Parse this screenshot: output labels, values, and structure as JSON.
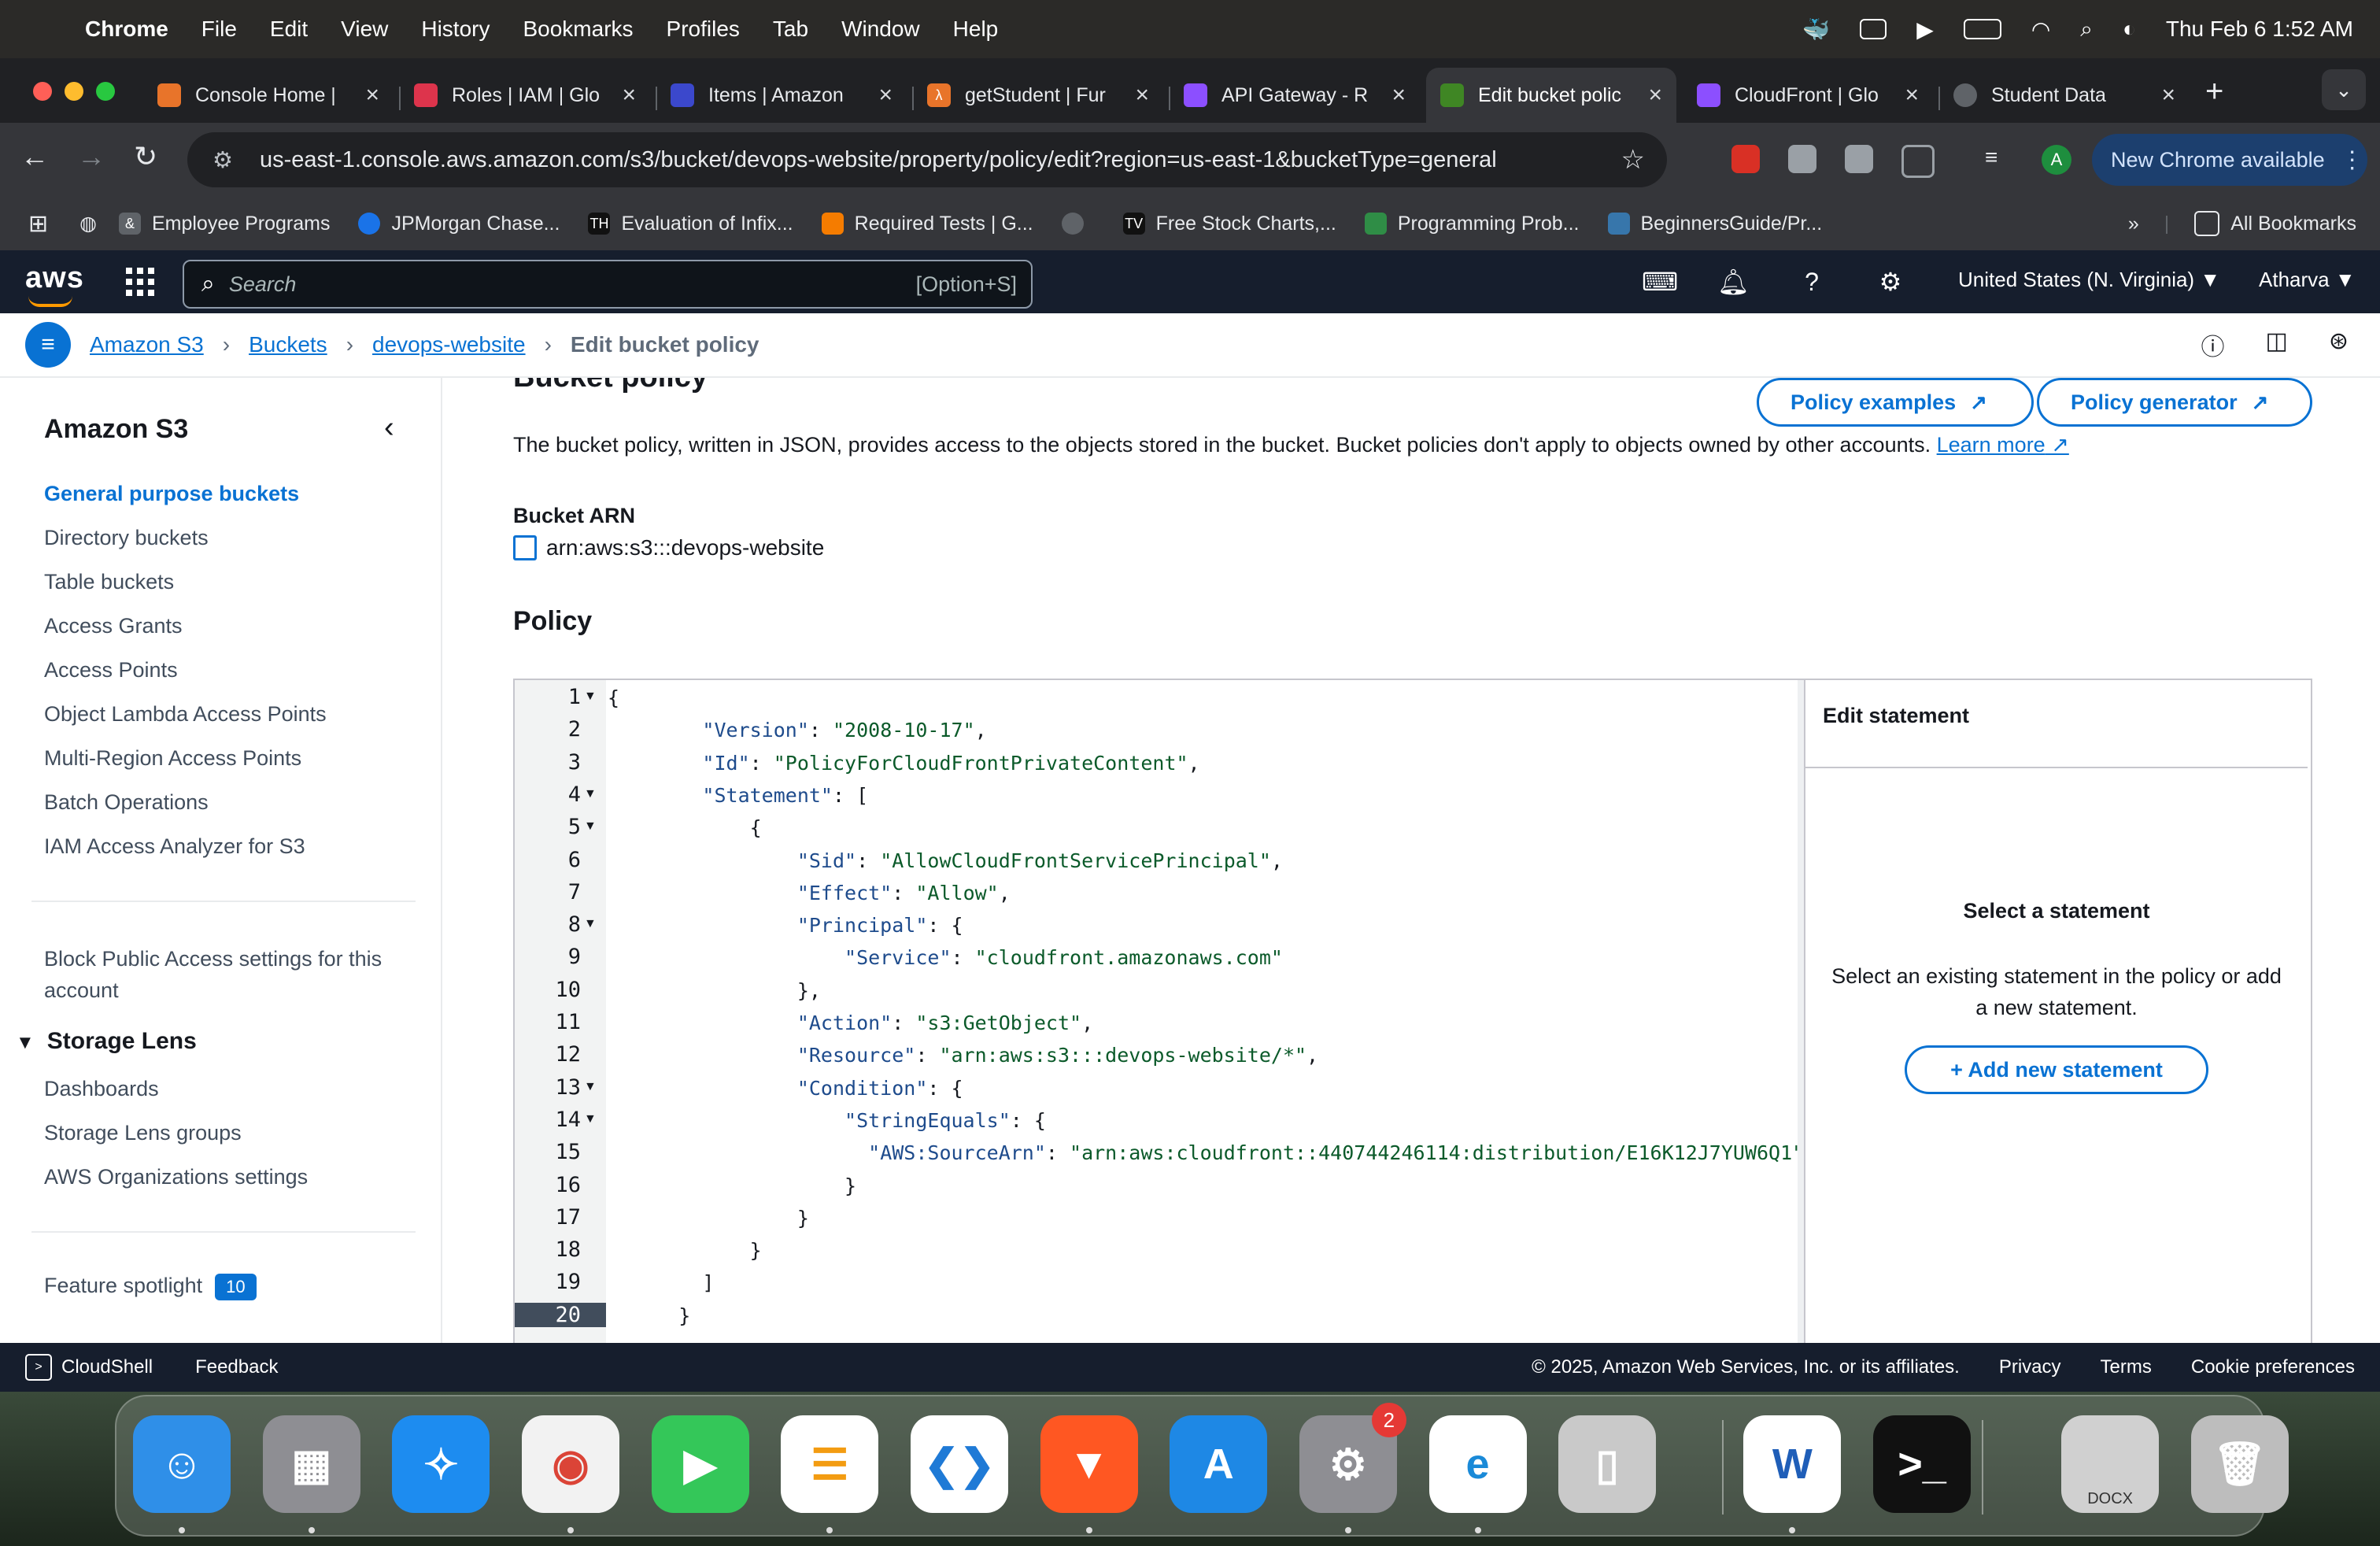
{
  "menubar": {
    "app": "Chrome",
    "items": [
      "File",
      "Edit",
      "View",
      "History",
      "Bookmarks",
      "Profiles",
      "Tab",
      "Window",
      "Help"
    ],
    "datetime": "Thu Feb 6  1:52 AM"
  },
  "tabs": [
    {
      "title": "Console Home |",
      "color": "#e8742a"
    },
    {
      "title": "Roles | IAM | Glo",
      "color": "#dd344c"
    },
    {
      "title": "Items | Amazon",
      "color": "#3b48cc"
    },
    {
      "title": "getStudent | Fur",
      "color": "#e8742a"
    },
    {
      "title": "API Gateway - R",
      "color": "#8c4fff"
    },
    {
      "title": "Edit bucket polic",
      "color": "#3f8624"
    },
    {
      "title": "CloudFront | Glo",
      "color": "#8c4fff"
    },
    {
      "title": "Student Data",
      "color": "#5f6368"
    }
  ],
  "toolbar": {
    "url": "us-east-1.console.aws.amazon.com/s3/bucket/devops-website/property/policy/edit?region=us-east-1&bucketType=general",
    "new_chrome": "New Chrome available",
    "avatar": "A"
  },
  "bookmarks": {
    "items": [
      "Employee Programs",
      "JPMorgan Chase...",
      "Evaluation of Infix...",
      "Required Tests | G...",
      "Free Stock Charts,...",
      "Programming Prob...",
      "BeginnersGuide/Pr..."
    ],
    "more": "»",
    "all": "All Bookmarks"
  },
  "awsnav": {
    "logo": "aws",
    "search_placeholder": "Search",
    "search_hint": "[Option+S]",
    "region": "United States (N. Virginia) ▼",
    "user": "Atharva ▼"
  },
  "breadcrumb": {
    "items": [
      "Amazon S3",
      "Buckets",
      "devops-website"
    ],
    "current": "Edit bucket policy"
  },
  "leftnav": {
    "title": "Amazon S3",
    "items": [
      "General purpose buckets",
      "Directory buckets",
      "Table buckets",
      "Access Grants",
      "Access Points",
      "Object Lambda Access Points",
      "Multi-Region Access Points",
      "Batch Operations",
      "IAM Access Analyzer for S3"
    ],
    "block_public": "Block Public Access settings for this account",
    "lens_header": "Storage Lens",
    "lens_items": [
      "Dashboards",
      "Storage Lens groups",
      "AWS Organizations settings"
    ],
    "feature": "Feature spotlight",
    "feature_count": "10"
  },
  "main": {
    "section_title": "Bucket policy",
    "policy_examples": "Policy examples",
    "policy_generator": "Policy generator",
    "description": "The bucket policy, written in JSON, provides access to the objects stored in the bucket. Bucket policies don't apply to objects owned by other accounts.",
    "learn_more": "Learn more",
    "arn_label": "Bucket ARN",
    "arn_value": "arn:aws:s3:::devops-website",
    "policy_label": "Policy"
  },
  "editor": {
    "lines": [
      "{",
      "        \"Version\": \"2008-10-17\",",
      "        \"Id\": \"PolicyForCloudFrontPrivateContent\",",
      "        \"Statement\": [",
      "            {",
      "                \"Sid\": \"AllowCloudFrontServicePrincipal\",",
      "                \"Effect\": \"Allow\",",
      "                \"Principal\": {",
      "                    \"Service\": \"cloudfront.amazonaws.com\"",
      "                },",
      "                \"Action\": \"s3:GetObject\",",
      "                \"Resource\": \"arn:aws:s3:::devops-website/*\",",
      "                \"Condition\": {",
      "                    \"StringEquals\": {",
      "                      \"AWS:SourceArn\": \"arn:aws:cloudfront::440744246114:distribution/E16K12J7YUW6Q1\"",
      "                    }",
      "                }",
      "            }",
      "        ]",
      "      }"
    ],
    "fold_lines": [
      1,
      4,
      5,
      8,
      13,
      14
    ],
    "current_line": 20
  },
  "sidepanel": {
    "header": "Edit statement",
    "title": "Select a statement",
    "desc": "Select an existing statement in the policy or add a new statement.",
    "add": "+  Add new statement"
  },
  "footer": {
    "cloudshell": "CloudShell",
    "feedback": "Feedback",
    "copyright": "© 2025, Amazon Web Services, Inc. or its affiliates.",
    "links": [
      "Privacy",
      "Terms",
      "Cookie preferences"
    ]
  },
  "dock": {
    "apps": [
      {
        "name": "finder",
        "color": "#2f8fe8"
      },
      {
        "name": "launchpad",
        "color": "#8e8e93"
      },
      {
        "name": "safari",
        "color": "#1d8cf0"
      },
      {
        "name": "chrome",
        "color": "#f2f2f2"
      },
      {
        "name": "facetime",
        "color": "#34c759"
      },
      {
        "name": "reminders",
        "color": "#ffffff"
      },
      {
        "name": "vscode",
        "color": "#ffffff"
      },
      {
        "name": "brave",
        "color": "#ff5722"
      },
      {
        "name": "app-store",
        "color": "#1e88e5"
      },
      {
        "name": "system-settings",
        "color": "#8e8e93"
      },
      {
        "name": "edge",
        "color": "#ffffff"
      },
      {
        "name": "iphone-mirroring",
        "color": "#c9c9c9"
      },
      {
        "name": "word",
        "color": "#ffffff"
      },
      {
        "name": "terminal",
        "color": "#111111"
      },
      {
        "name": "document-stack",
        "color": "#d0d0d0"
      },
      {
        "name": "trash",
        "color": "#bdbdbd"
      }
    ],
    "settings_badge": "2",
    "doc_label": "DOCX"
  }
}
